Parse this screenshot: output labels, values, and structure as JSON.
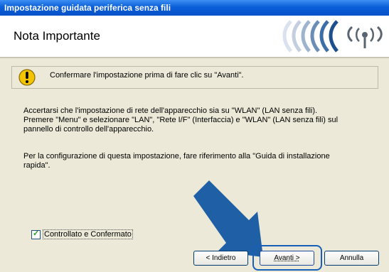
{
  "window": {
    "title": "Impostazione guidata periferica senza fili"
  },
  "header": {
    "title": "Nota Importante"
  },
  "note": {
    "text": "Confermare l'impostazione prima di fare clic su \"Avanti\"."
  },
  "paragraphs": {
    "p1": "Accertarsi che l'impostazione di rete dell'apparecchio sia su  \"WLAN\" (LAN senza fili).\nPremere \"Menu\" e selezionare \"LAN\", \"Rete I/F\" (Interfaccia) e \"WLAN\" (LAN senza fili) sul\npannello di controllo dell'apparecchio.",
    "p2": "Per la configurazione di questa impostazione, fare riferimento alla \"Guida di installazione\nrapida\"."
  },
  "checkbox": {
    "label": "Controllato e Confermato",
    "checked": true
  },
  "buttons": {
    "back": "< Indietro",
    "next": "Avanti >",
    "cancel": "Annulla"
  },
  "colors": {
    "titlebar": "#0a5fd8",
    "accent": "#1660b8",
    "arrow": "#1f5fa6"
  }
}
